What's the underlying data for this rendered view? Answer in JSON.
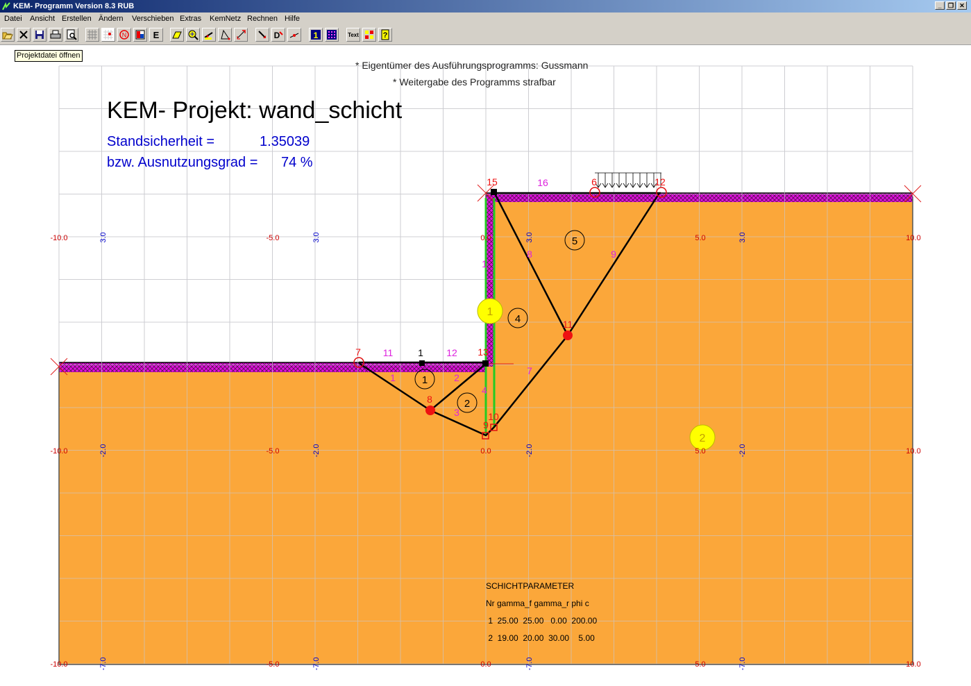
{
  "window": {
    "title": "KEM- Programm Version 8.3 RUB",
    "minimize": "_",
    "restore": "❐",
    "close": "✕"
  },
  "menu": [
    "Datei",
    "Ansicht",
    "Erstellen",
    "Ändern",
    "Verschieben",
    "Extras",
    "KemNetz",
    "Rechnen",
    "Hilfe"
  ],
  "toolbar": {
    "buttons": [
      "open-file-icon",
      "close-file-icon",
      "save-icon",
      "print-icon",
      "print-preview-icon",
      "grid-icon",
      "point-icon",
      "node-n-icon",
      "layer-icon",
      "e-icon",
      "draw-icon",
      "zoom-icon",
      "arrow-load-icon",
      "polygon-icon",
      "rotate-icon",
      "move-point-icon",
      "d-icon",
      "line-edit-icon",
      "one-icon",
      "matrix-icon",
      "text-icon",
      "colors-icon",
      "help-icon"
    ],
    "e_label": "E",
    "n_label": "N",
    "d_label": "D",
    "one_label": "1",
    "text_label": "Text"
  },
  "tooltip": "Projektdatei öffnen",
  "notice": {
    "line1": "* Eigentümer des Ausführungsprogramms: Gussmann",
    "line2": "* Weitergabe des Programms strafbar"
  },
  "project": {
    "title": "KEM- Projekt: wand_schicht",
    "safety_label": "Standsicherheit =",
    "safety_value": "1.35039",
    "utilization_label": "bzw. Ausnutzungsgrad =",
    "utilization_value": "74 %"
  },
  "schicht": {
    "heading": "SCHICHTPARAMETER",
    "header": "Nr gamma_f gamma_r phi c",
    "rows": [
      " 1  25.00  25.00   0.00  200.00",
      " 2  19.00  20.00  30.00    5.00"
    ]
  },
  "drawing": {
    "colors": {
      "soil": "#fba73a",
      "hatch": "#e010e0",
      "wall_green": "#22cc22",
      "node_red": "#ee1111",
      "label_magenta": "#dd22dd",
      "axis_red": "#cc0000",
      "axis_blue": "#0000cc",
      "grid": "#d8d8d8",
      "layer_marker": "#ffff00"
    },
    "x_ticks": [
      "-10.0",
      "-5.0",
      "0.0",
      "5.0",
      "10.0"
    ],
    "y_rows": [
      {
        "labels": [
          "-10.0",
          "-5.0",
          "0.0",
          "5.0",
          "10.0"
        ],
        "blue": [
          "3.0",
          "3.0",
          "3.0",
          "3.0"
        ]
      },
      {
        "labels": [
          "-10.0",
          "-5.0",
          "0.0",
          "5.0",
          "10.0"
        ],
        "blue": [
          "-2.0",
          "-2.0",
          "-2.0",
          "-2.0"
        ]
      },
      {
        "labels": [
          "-10.0",
          "-5.0",
          "0.0",
          "5.0",
          "10.0"
        ],
        "blue": [
          "-7.0",
          "-7.0",
          "-7.0",
          "-7.0"
        ]
      }
    ],
    "body_labels": [
      "1",
      "2",
      "3",
      "4",
      "5"
    ],
    "node_labels": [
      "1",
      "7",
      "8",
      "10",
      "11",
      "12",
      "13",
      "15",
      "16",
      "6",
      "9"
    ],
    "edge_labels": [
      "11",
      "12",
      "1",
      "2",
      "3",
      "4",
      "7",
      "8",
      "9",
      "16",
      "1"
    ],
    "layer_labels": [
      "1",
      "2"
    ]
  }
}
